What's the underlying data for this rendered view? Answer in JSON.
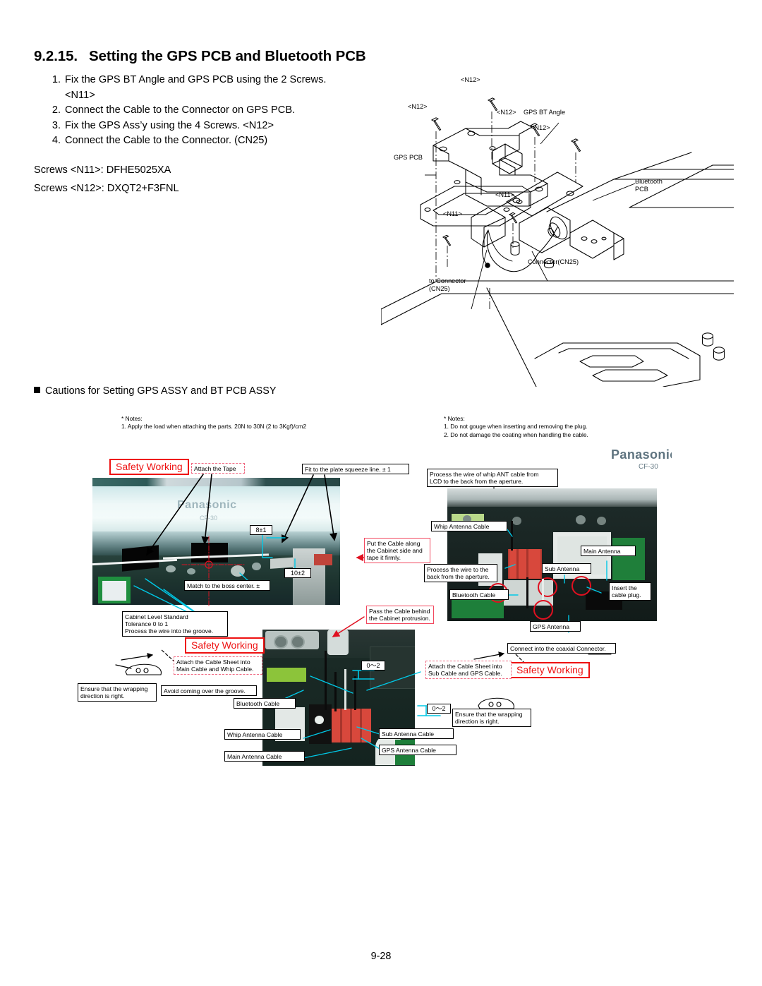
{
  "heading": {
    "number": "9.2.15.",
    "title": "Setting the GPS PCB and Bluetooth PCB"
  },
  "steps": [
    {
      "n": "1.",
      "text": "Fix the GPS BT Angle and GPS PCB using the 2 Screws.",
      "cont": "<N11>"
    },
    {
      "n": "2.",
      "text": "Connect the Cable to the Connector on GPS PCB.",
      "cont": ""
    },
    {
      "n": "3.",
      "text": "Fix the GPS Ass’y using the 4 Screws. <N12>",
      "cont": ""
    },
    {
      "n": "4.",
      "text": "Connect the Cable to the Connector. (CN25)",
      "cont": ""
    }
  ],
  "screws": [
    "Screws <N11>: DFHE5025XA",
    "Screws <N12>: DXQT2+F3FNL"
  ],
  "cautions_title": "Cautions for Setting GPS ASSY and BT PCB ASSY",
  "notes_left": {
    "title": "* Notes:",
    "items": [
      "1. Apply the load when attaching the parts. 20N to 30N (2 to 3Kgf)/cm2"
    ]
  },
  "notes_right": {
    "title": "* Notes:",
    "items": [
      "1. Do not gouge when inserting and removing the plug.",
      "2. Do not damage the coating when handling the cable."
    ]
  },
  "exploded_labels": {
    "n12_a": "<N12>",
    "n12_b": "<N12>",
    "n12_c": "<N12>",
    "n12_d": "<N12>",
    "gps_bt_angle": "GPS BT Angle",
    "gps_pcb": "GPS PCB",
    "n11_a": "<N11>",
    "n11_b": "<N11>",
    "bluetooth_pcb": "Bluetooth\nPCB",
    "connector_cn25": "Connector(CN25)",
    "to_connector_cn25": "to Connector\n(CN25)"
  },
  "device_brand": {
    "name": "Panasonic",
    "model": "CF-30"
  },
  "safety_labels": [
    "Safety Working",
    "Safety Working",
    "Safety Working"
  ],
  "callouts": [
    {
      "id": "attach-the-tape",
      "text": "Attach the Tape"
    },
    {
      "id": "fit-plate-squeeze-line",
      "text": "Fit to the plate squeeze line. ± 1"
    },
    {
      "id": "process-whip-ant-cable",
      "text": "Process the wire of whip ANT cable from\nLCD to the back from the aperture."
    },
    {
      "id": "dim-8",
      "text": "8±1"
    },
    {
      "id": "dim-10",
      "text": "10±2"
    },
    {
      "id": "put-cable-along-cabinet",
      "text": "Put the Cable along\nthe Cabinet side and\ntape it firmly."
    },
    {
      "id": "whip-antenna-cable-r",
      "text": "Whip Antenna Cable"
    },
    {
      "id": "main-antenna",
      "text": "Main Antenna"
    },
    {
      "id": "sub-antenna",
      "text": "Sub Antenna"
    },
    {
      "id": "process-wire-back",
      "text": "Process the wire to the\nback from the aperture."
    },
    {
      "id": "insert-cable-plug",
      "text": "Insert the\ncable plug."
    },
    {
      "id": "bluetooth-cable-r",
      "text": "Bluetooth Cable"
    },
    {
      "id": "match-boss-center",
      "text": "Match to the boss center. ±"
    },
    {
      "id": "gps-antenna",
      "text": "GPS Antenna"
    },
    {
      "id": "cabinet-level-standard",
      "text": "Cabinet Level Standard\nTolerance 0 to 1\nProcess the wire into the groove."
    },
    {
      "id": "pass-cable-behind",
      "text": "Pass the Cable behind\nthe Cabinet protrusion."
    },
    {
      "id": "connect-coaxial-connector",
      "text": "Connect into the coaxial Connector."
    },
    {
      "id": "attach-sheet-main-whip",
      "text": "Attach the Cable Sheet into\nMain Cable and Whip Cable."
    },
    {
      "id": "attach-sheet-sub-gps",
      "text": "Attach the Cable Sheet into\nSub Cable and GPS Cable."
    },
    {
      "id": "ensure-wrapping-left",
      "text": "Ensure that the wrapping\ndirection is right."
    },
    {
      "id": "ensure-wrapping-right",
      "text": "Ensure that the wrapping\ndirection is right."
    },
    {
      "id": "avoid-over-groove",
      "text": "Avoid coming over the groove."
    },
    {
      "id": "dim-0-2-a",
      "text": "0～2"
    },
    {
      "id": "dim-0-2-b",
      "text": "0～2"
    },
    {
      "id": "bluetooth-cable-c",
      "text": "Bluetooth Cable"
    },
    {
      "id": "whip-antenna-cable-c",
      "text": "Whip Antenna Cable"
    },
    {
      "id": "main-antenna-cable-c",
      "text": "Main Antenna Cable"
    },
    {
      "id": "sub-antenna-cable-c",
      "text": "Sub Antenna Cable"
    },
    {
      "id": "gps-antenna-cable-c",
      "text": "GPS Antenna Cable"
    }
  ],
  "footer": {
    "page": "9-28"
  },
  "colors": {
    "safety_red": "#ee1111",
    "callout_dashed_red": "#f06c84",
    "leader_cyan": "#00c8e6",
    "leader_red": "#e01020",
    "leader_black": "#000000"
  }
}
